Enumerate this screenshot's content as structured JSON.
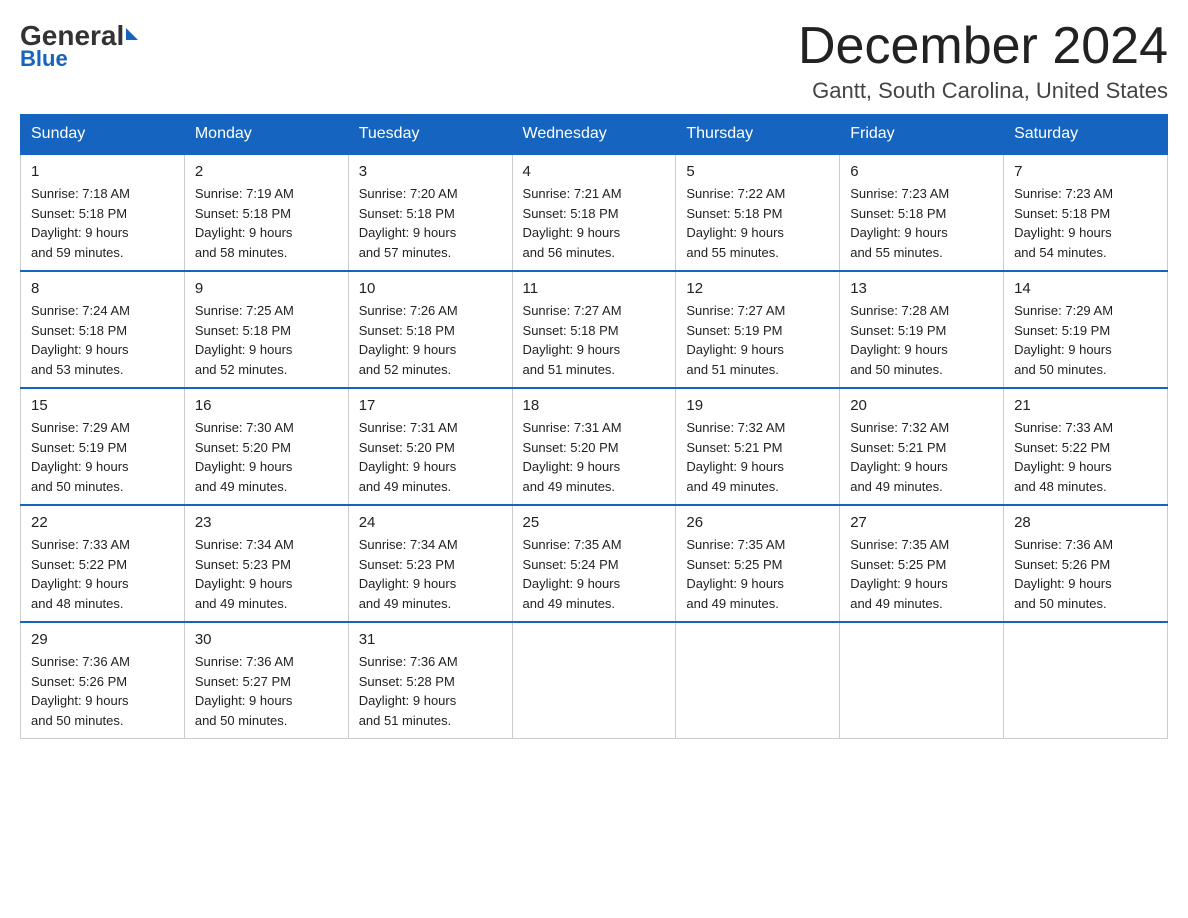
{
  "header": {
    "logo_general": "General",
    "logo_blue": "Blue",
    "month_title": "December 2024",
    "location": "Gantt, South Carolina, United States"
  },
  "days_of_week": [
    "Sunday",
    "Monday",
    "Tuesday",
    "Wednesday",
    "Thursday",
    "Friday",
    "Saturday"
  ],
  "weeks": [
    [
      {
        "day": "1",
        "sunrise": "7:18 AM",
        "sunset": "5:18 PM",
        "daylight": "9 hours and 59 minutes."
      },
      {
        "day": "2",
        "sunrise": "7:19 AM",
        "sunset": "5:18 PM",
        "daylight": "9 hours and 58 minutes."
      },
      {
        "day": "3",
        "sunrise": "7:20 AM",
        "sunset": "5:18 PM",
        "daylight": "9 hours and 57 minutes."
      },
      {
        "day": "4",
        "sunrise": "7:21 AM",
        "sunset": "5:18 PM",
        "daylight": "9 hours and 56 minutes."
      },
      {
        "day": "5",
        "sunrise": "7:22 AM",
        "sunset": "5:18 PM",
        "daylight": "9 hours and 55 minutes."
      },
      {
        "day": "6",
        "sunrise": "7:23 AM",
        "sunset": "5:18 PM",
        "daylight": "9 hours and 55 minutes."
      },
      {
        "day": "7",
        "sunrise": "7:23 AM",
        "sunset": "5:18 PM",
        "daylight": "9 hours and 54 minutes."
      }
    ],
    [
      {
        "day": "8",
        "sunrise": "7:24 AM",
        "sunset": "5:18 PM",
        "daylight": "9 hours and 53 minutes."
      },
      {
        "day": "9",
        "sunrise": "7:25 AM",
        "sunset": "5:18 PM",
        "daylight": "9 hours and 52 minutes."
      },
      {
        "day": "10",
        "sunrise": "7:26 AM",
        "sunset": "5:18 PM",
        "daylight": "9 hours and 52 minutes."
      },
      {
        "day": "11",
        "sunrise": "7:27 AM",
        "sunset": "5:18 PM",
        "daylight": "9 hours and 51 minutes."
      },
      {
        "day": "12",
        "sunrise": "7:27 AM",
        "sunset": "5:19 PM",
        "daylight": "9 hours and 51 minutes."
      },
      {
        "day": "13",
        "sunrise": "7:28 AM",
        "sunset": "5:19 PM",
        "daylight": "9 hours and 50 minutes."
      },
      {
        "day": "14",
        "sunrise": "7:29 AM",
        "sunset": "5:19 PM",
        "daylight": "9 hours and 50 minutes."
      }
    ],
    [
      {
        "day": "15",
        "sunrise": "7:29 AM",
        "sunset": "5:19 PM",
        "daylight": "9 hours and 50 minutes."
      },
      {
        "day": "16",
        "sunrise": "7:30 AM",
        "sunset": "5:20 PM",
        "daylight": "9 hours and 49 minutes."
      },
      {
        "day": "17",
        "sunrise": "7:31 AM",
        "sunset": "5:20 PM",
        "daylight": "9 hours and 49 minutes."
      },
      {
        "day": "18",
        "sunrise": "7:31 AM",
        "sunset": "5:20 PM",
        "daylight": "9 hours and 49 minutes."
      },
      {
        "day": "19",
        "sunrise": "7:32 AM",
        "sunset": "5:21 PM",
        "daylight": "9 hours and 49 minutes."
      },
      {
        "day": "20",
        "sunrise": "7:32 AM",
        "sunset": "5:21 PM",
        "daylight": "9 hours and 49 minutes."
      },
      {
        "day": "21",
        "sunrise": "7:33 AM",
        "sunset": "5:22 PM",
        "daylight": "9 hours and 48 minutes."
      }
    ],
    [
      {
        "day": "22",
        "sunrise": "7:33 AM",
        "sunset": "5:22 PM",
        "daylight": "9 hours and 48 minutes."
      },
      {
        "day": "23",
        "sunrise": "7:34 AM",
        "sunset": "5:23 PM",
        "daylight": "9 hours and 49 minutes."
      },
      {
        "day": "24",
        "sunrise": "7:34 AM",
        "sunset": "5:23 PM",
        "daylight": "9 hours and 49 minutes."
      },
      {
        "day": "25",
        "sunrise": "7:35 AM",
        "sunset": "5:24 PM",
        "daylight": "9 hours and 49 minutes."
      },
      {
        "day": "26",
        "sunrise": "7:35 AM",
        "sunset": "5:25 PM",
        "daylight": "9 hours and 49 minutes."
      },
      {
        "day": "27",
        "sunrise": "7:35 AM",
        "sunset": "5:25 PM",
        "daylight": "9 hours and 49 minutes."
      },
      {
        "day": "28",
        "sunrise": "7:36 AM",
        "sunset": "5:26 PM",
        "daylight": "9 hours and 50 minutes."
      }
    ],
    [
      {
        "day": "29",
        "sunrise": "7:36 AM",
        "sunset": "5:26 PM",
        "daylight": "9 hours and 50 minutes."
      },
      {
        "day": "30",
        "sunrise": "7:36 AM",
        "sunset": "5:27 PM",
        "daylight": "9 hours and 50 minutes."
      },
      {
        "day": "31",
        "sunrise": "7:36 AM",
        "sunset": "5:28 PM",
        "daylight": "9 hours and 51 minutes."
      },
      null,
      null,
      null,
      null
    ]
  ],
  "labels": {
    "sunrise": "Sunrise:",
    "sunset": "Sunset:",
    "daylight": "Daylight:"
  }
}
